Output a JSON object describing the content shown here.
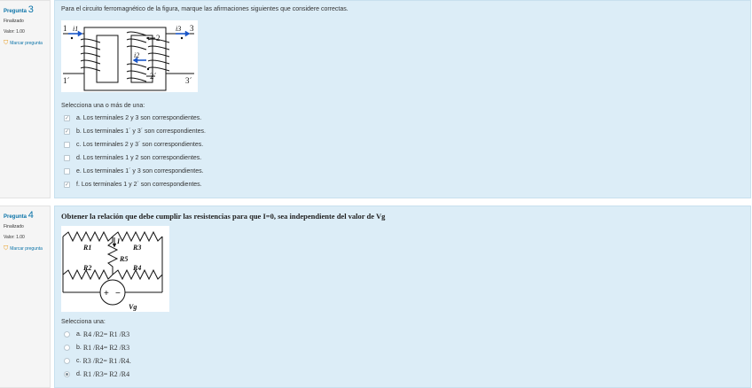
{
  "questions": [
    {
      "label": "Pregunta",
      "number": "3",
      "state": "Finalizado",
      "grade": "Valor: 1.00",
      "flag_label": "Marcar pregunta",
      "text": "Para el circuito ferromagnético de la figura, marque las afirmaciones siguientes que considere correctas.",
      "figure": {
        "t1": "1",
        "i1": "i1",
        "t2": "2",
        "i3": "i3",
        "t3": "3",
        "i2": "i2",
        "t2p": "2´",
        "t1p": "1´",
        "t3p": "3´"
      },
      "prompt": "Selecciona una o más de una:",
      "options": [
        {
          "text": "a. Los terminales 2 y 3 son correspondientes.",
          "checked": true
        },
        {
          "text": "b. Los terminales 1´ y 3´ son correspondientes.",
          "checked": true
        },
        {
          "text": "c. Los terminales 2 y 3´ son correspondientes.",
          "checked": false
        },
        {
          "text": "d. Los terminales 1 y 2 son correspondientes.",
          "checked": false
        },
        {
          "text": "e. Los terminales 1´ y 3 son correspondientes.",
          "checked": false
        },
        {
          "text": "f. Los terminales 1 y 2´ son correspondientes.",
          "checked": true
        }
      ]
    },
    {
      "label": "Pregunta",
      "number": "4",
      "state": "Finalizado",
      "grade": "Valor: 1.00",
      "flag_label": "Marcar pregunta",
      "text": "Obtener la relación que debe cumplir las resistencias para que I=0, sea independiente del valor de Vg",
      "figure": {
        "r1": "R1",
        "r3": "R3",
        "r5": "R5",
        "r2": "R2",
        "r4": "R4",
        "i": "I",
        "vg": "Vg",
        "plus": "+",
        "minus": "−"
      },
      "prompt": "Selecciona una:",
      "options": [
        {
          "letter": "a.",
          "text": "R4 /R2= R1 /R3",
          "selected": false
        },
        {
          "letter": "b.",
          "text": "R1 /R4= R2 /R3",
          "selected": false
        },
        {
          "letter": "c.",
          "text": "R3 /R2= R1 /R4.",
          "selected": false
        },
        {
          "letter": "d.",
          "text": "R1 /R3= R2 /R4",
          "selected": true
        }
      ]
    }
  ],
  "colors": {
    "accent": "#0a73a8",
    "content_bg": "#dcedf7",
    "info_bg": "#f5f5f5",
    "arrow": "#1a56c8",
    "flag": "#e89a1c"
  }
}
